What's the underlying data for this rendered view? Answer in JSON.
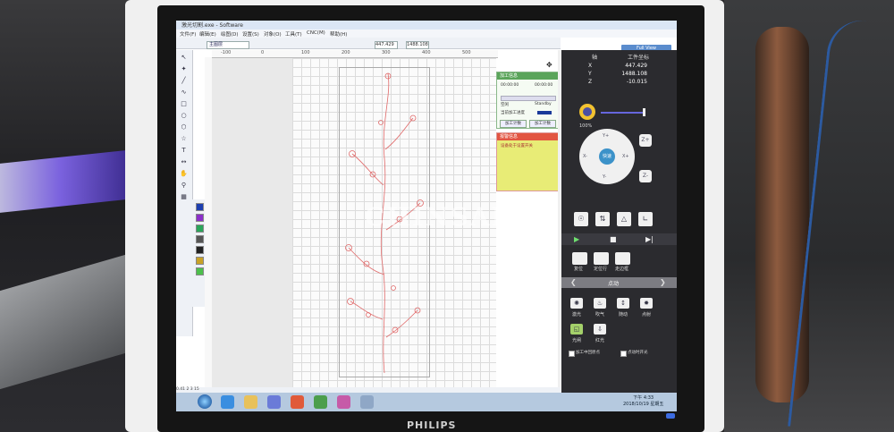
{
  "window": {
    "title": "激光切割.exe - Software"
  },
  "menu": {
    "items": [
      "文件(F)",
      "编辑(E)",
      "绘图(D)",
      "设置(S)",
      "对象(O)",
      "工具(T)",
      "CNC(M)",
      "帮助(H)"
    ]
  },
  "toolbar": {
    "layer": "主图层",
    "x_field": "447.429",
    "y_field": "1488.108",
    "full_view_label": "Full View"
  },
  "ruler": {
    "top_labels": [
      "-100",
      "0",
      "100",
      "200",
      "300",
      "400",
      "500"
    ]
  },
  "status_panel": {
    "title": "加工信息",
    "rows": [
      {
        "label": "00:00:00",
        "value": "00:00:00"
      },
      {
        "label": "空闲",
        "value": "Standby"
      },
      {
        "label": "当前加工进度",
        "value": ""
      }
    ],
    "progress": 0,
    "btn_left": "加工计数",
    "btn_right": "加工计数"
  },
  "alarm_panel": {
    "title": "报警信息",
    "message": "设备处于设置开关"
  },
  "control": {
    "axis_header": "轴",
    "coord_header": "工件坐标",
    "axes": [
      {
        "name": "X",
        "value": "447.429"
      },
      {
        "name": "Y",
        "value": "1488.108"
      },
      {
        "name": "Z",
        "value": "-10.015"
      }
    ],
    "speed_percent": "100%",
    "speed_value": 1.0,
    "dpad": {
      "center": "快速",
      "up": "Y+",
      "down": "Y-",
      "left": "X-",
      "right": "X+"
    },
    "z_up": "Z+",
    "z_down": "Z-",
    "action_labels": [
      "复位",
      "定位行",
      "走边框"
    ],
    "nav_title": "点动",
    "fn_labels": [
      "激光",
      "吹气",
      "随动",
      "点射",
      "光闸",
      "红光"
    ],
    "checkbox_labels": [
      "加工中回原点",
      "点动时开光"
    ]
  },
  "statusbar": {
    "text": "0.41  2   3   15"
  },
  "taskbar": {
    "clock_time": "下午 4:33",
    "clock_date": "2018/10/19 星期五"
  },
  "monitor": {
    "brand": "PHILIPS"
  },
  "watermark": "CHINSAIL",
  "colors": {
    "status_green": "#5aa45a",
    "alarm_red": "#e25541",
    "alarm_yellow": "#e8ec76",
    "panel_dark": "#2b2b2f",
    "accent_blue": "#3c92c9"
  }
}
